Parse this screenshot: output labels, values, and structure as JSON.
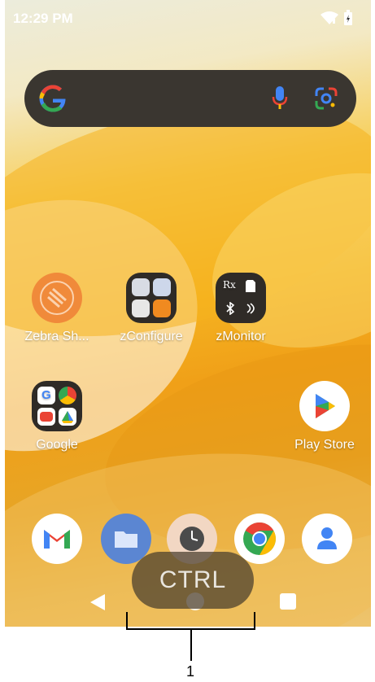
{
  "status_bar": {
    "time": "12:29 PM",
    "icons": [
      "wifi-icon",
      "battery-icon"
    ]
  },
  "search_bar": {
    "icons": [
      "google-g-icon",
      "microphone-icon",
      "google-lens-icon"
    ]
  },
  "apps": [
    {
      "label": "Zebra Sh..."
    },
    {
      "label": "zConfigure"
    },
    {
      "label": "zMonitor"
    },
    {
      "label": "Google"
    },
    {
      "label": "Play Store"
    }
  ],
  "zmonitor_folder": {
    "rx": "Rx"
  },
  "dock": {
    "icons": [
      "gmail-icon",
      "files-icon",
      "clock-icon",
      "chrome-icon",
      "contacts-icon"
    ]
  },
  "overlay": {
    "ctrl_label": "CTRL"
  },
  "nav_bar": {
    "icons": [
      "back-icon",
      "home-icon",
      "recents-icon"
    ]
  },
  "callout": {
    "number": "1"
  },
  "colors": {
    "accent_orange": "#f0a018",
    "search_bg": "#3a3630",
    "ctrl_bg": "#463c2d"
  }
}
